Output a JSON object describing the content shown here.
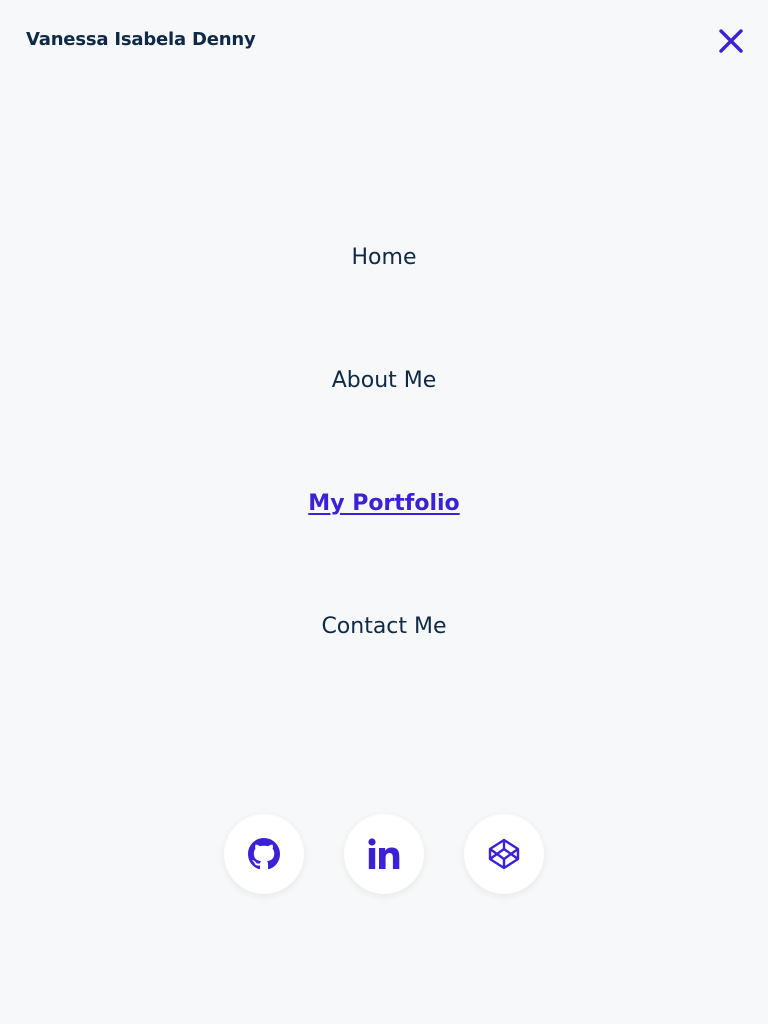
{
  "header": {
    "site_name": "Vanessa Isabela Denny",
    "close_icon": "close-icon"
  },
  "nav": {
    "items": [
      {
        "label": "Home",
        "active": false
      },
      {
        "label": "About Me",
        "active": false
      },
      {
        "label": "My Portfolio",
        "active": true
      },
      {
        "label": "Contact Me",
        "active": false
      }
    ]
  },
  "social": [
    {
      "icon": "github-icon"
    },
    {
      "icon": "linkedin-icon"
    },
    {
      "icon": "codepen-icon"
    }
  ],
  "colors": {
    "background": "#f6f8fa",
    "text": "#0e2a47",
    "accent": "#3b22d6"
  }
}
